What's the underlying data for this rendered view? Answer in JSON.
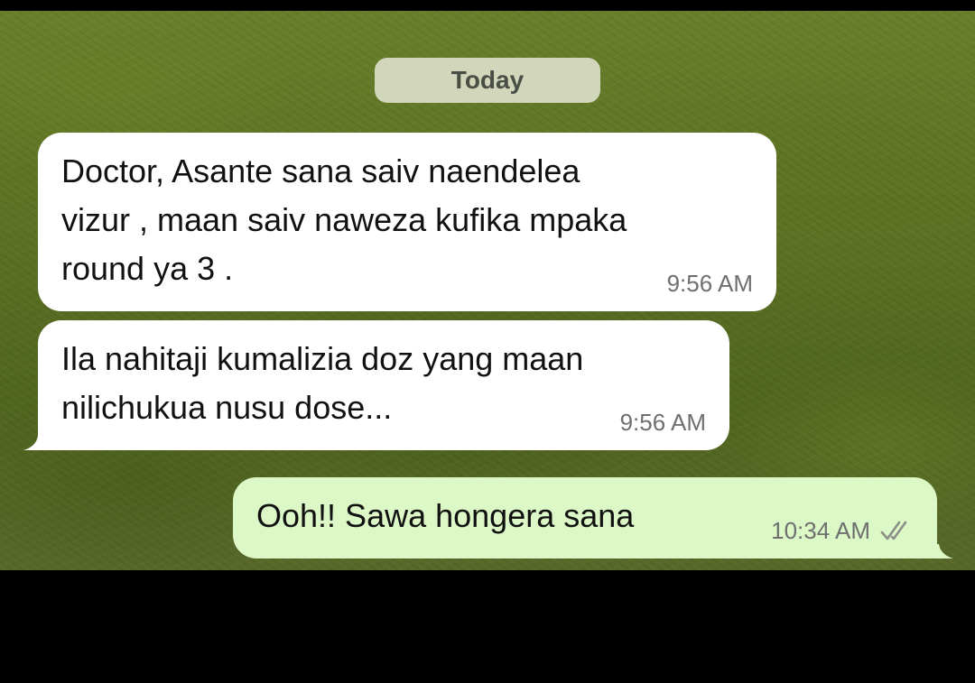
{
  "chat": {
    "date_chip": "Today",
    "messages": [
      {
        "direction": "incoming",
        "text": "Doctor, Asante sana saiv naendelea\nvizur , maan saiv naweza kufika mpaka\nround ya 3 .",
        "time": "9:56 AM"
      },
      {
        "direction": "incoming",
        "text": "Ila nahitaji kumalizia doz yang maan\nnilichukua nusu dose...",
        "time": "9:56 AM"
      },
      {
        "direction": "outgoing",
        "text": "Ooh!! Sawa hongera sana",
        "time": "10:34 AM",
        "status_icon": "double-check-icon"
      }
    ]
  },
  "colors": {
    "incoming_bubble": "#ffffff",
    "outgoing_bubble": "#dcf8c6",
    "date_chip": "#d2d6ba",
    "wallpaper": "#5c7124"
  }
}
